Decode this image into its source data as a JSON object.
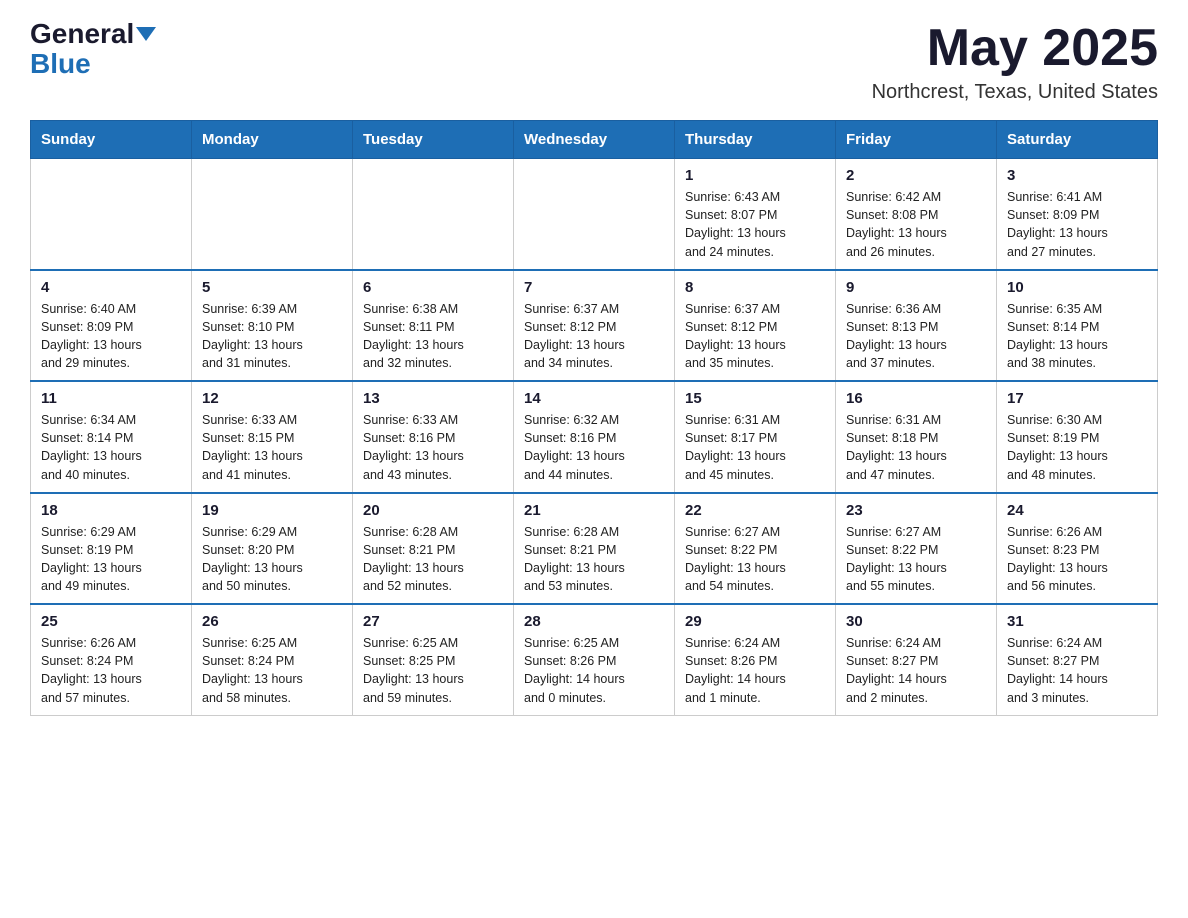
{
  "header": {
    "logo_general": "General",
    "logo_blue": "Blue",
    "month_title": "May 2025",
    "location": "Northcrest, Texas, United States"
  },
  "days_of_week": [
    "Sunday",
    "Monday",
    "Tuesday",
    "Wednesday",
    "Thursday",
    "Friday",
    "Saturday"
  ],
  "weeks": [
    [
      {
        "day": "",
        "info": ""
      },
      {
        "day": "",
        "info": ""
      },
      {
        "day": "",
        "info": ""
      },
      {
        "day": "",
        "info": ""
      },
      {
        "day": "1",
        "info": "Sunrise: 6:43 AM\nSunset: 8:07 PM\nDaylight: 13 hours\nand 24 minutes."
      },
      {
        "day": "2",
        "info": "Sunrise: 6:42 AM\nSunset: 8:08 PM\nDaylight: 13 hours\nand 26 minutes."
      },
      {
        "day": "3",
        "info": "Sunrise: 6:41 AM\nSunset: 8:09 PM\nDaylight: 13 hours\nand 27 minutes."
      }
    ],
    [
      {
        "day": "4",
        "info": "Sunrise: 6:40 AM\nSunset: 8:09 PM\nDaylight: 13 hours\nand 29 minutes."
      },
      {
        "day": "5",
        "info": "Sunrise: 6:39 AM\nSunset: 8:10 PM\nDaylight: 13 hours\nand 31 minutes."
      },
      {
        "day": "6",
        "info": "Sunrise: 6:38 AM\nSunset: 8:11 PM\nDaylight: 13 hours\nand 32 minutes."
      },
      {
        "day": "7",
        "info": "Sunrise: 6:37 AM\nSunset: 8:12 PM\nDaylight: 13 hours\nand 34 minutes."
      },
      {
        "day": "8",
        "info": "Sunrise: 6:37 AM\nSunset: 8:12 PM\nDaylight: 13 hours\nand 35 minutes."
      },
      {
        "day": "9",
        "info": "Sunrise: 6:36 AM\nSunset: 8:13 PM\nDaylight: 13 hours\nand 37 minutes."
      },
      {
        "day": "10",
        "info": "Sunrise: 6:35 AM\nSunset: 8:14 PM\nDaylight: 13 hours\nand 38 minutes."
      }
    ],
    [
      {
        "day": "11",
        "info": "Sunrise: 6:34 AM\nSunset: 8:14 PM\nDaylight: 13 hours\nand 40 minutes."
      },
      {
        "day": "12",
        "info": "Sunrise: 6:33 AM\nSunset: 8:15 PM\nDaylight: 13 hours\nand 41 minutes."
      },
      {
        "day": "13",
        "info": "Sunrise: 6:33 AM\nSunset: 8:16 PM\nDaylight: 13 hours\nand 43 minutes."
      },
      {
        "day": "14",
        "info": "Sunrise: 6:32 AM\nSunset: 8:16 PM\nDaylight: 13 hours\nand 44 minutes."
      },
      {
        "day": "15",
        "info": "Sunrise: 6:31 AM\nSunset: 8:17 PM\nDaylight: 13 hours\nand 45 minutes."
      },
      {
        "day": "16",
        "info": "Sunrise: 6:31 AM\nSunset: 8:18 PM\nDaylight: 13 hours\nand 47 minutes."
      },
      {
        "day": "17",
        "info": "Sunrise: 6:30 AM\nSunset: 8:19 PM\nDaylight: 13 hours\nand 48 minutes."
      }
    ],
    [
      {
        "day": "18",
        "info": "Sunrise: 6:29 AM\nSunset: 8:19 PM\nDaylight: 13 hours\nand 49 minutes."
      },
      {
        "day": "19",
        "info": "Sunrise: 6:29 AM\nSunset: 8:20 PM\nDaylight: 13 hours\nand 50 minutes."
      },
      {
        "day": "20",
        "info": "Sunrise: 6:28 AM\nSunset: 8:21 PM\nDaylight: 13 hours\nand 52 minutes."
      },
      {
        "day": "21",
        "info": "Sunrise: 6:28 AM\nSunset: 8:21 PM\nDaylight: 13 hours\nand 53 minutes."
      },
      {
        "day": "22",
        "info": "Sunrise: 6:27 AM\nSunset: 8:22 PM\nDaylight: 13 hours\nand 54 minutes."
      },
      {
        "day": "23",
        "info": "Sunrise: 6:27 AM\nSunset: 8:22 PM\nDaylight: 13 hours\nand 55 minutes."
      },
      {
        "day": "24",
        "info": "Sunrise: 6:26 AM\nSunset: 8:23 PM\nDaylight: 13 hours\nand 56 minutes."
      }
    ],
    [
      {
        "day": "25",
        "info": "Sunrise: 6:26 AM\nSunset: 8:24 PM\nDaylight: 13 hours\nand 57 minutes."
      },
      {
        "day": "26",
        "info": "Sunrise: 6:25 AM\nSunset: 8:24 PM\nDaylight: 13 hours\nand 58 minutes."
      },
      {
        "day": "27",
        "info": "Sunrise: 6:25 AM\nSunset: 8:25 PM\nDaylight: 13 hours\nand 59 minutes."
      },
      {
        "day": "28",
        "info": "Sunrise: 6:25 AM\nSunset: 8:26 PM\nDaylight: 14 hours\nand 0 minutes."
      },
      {
        "day": "29",
        "info": "Sunrise: 6:24 AM\nSunset: 8:26 PM\nDaylight: 14 hours\nand 1 minute."
      },
      {
        "day": "30",
        "info": "Sunrise: 6:24 AM\nSunset: 8:27 PM\nDaylight: 14 hours\nand 2 minutes."
      },
      {
        "day": "31",
        "info": "Sunrise: 6:24 AM\nSunset: 8:27 PM\nDaylight: 14 hours\nand 3 minutes."
      }
    ]
  ]
}
